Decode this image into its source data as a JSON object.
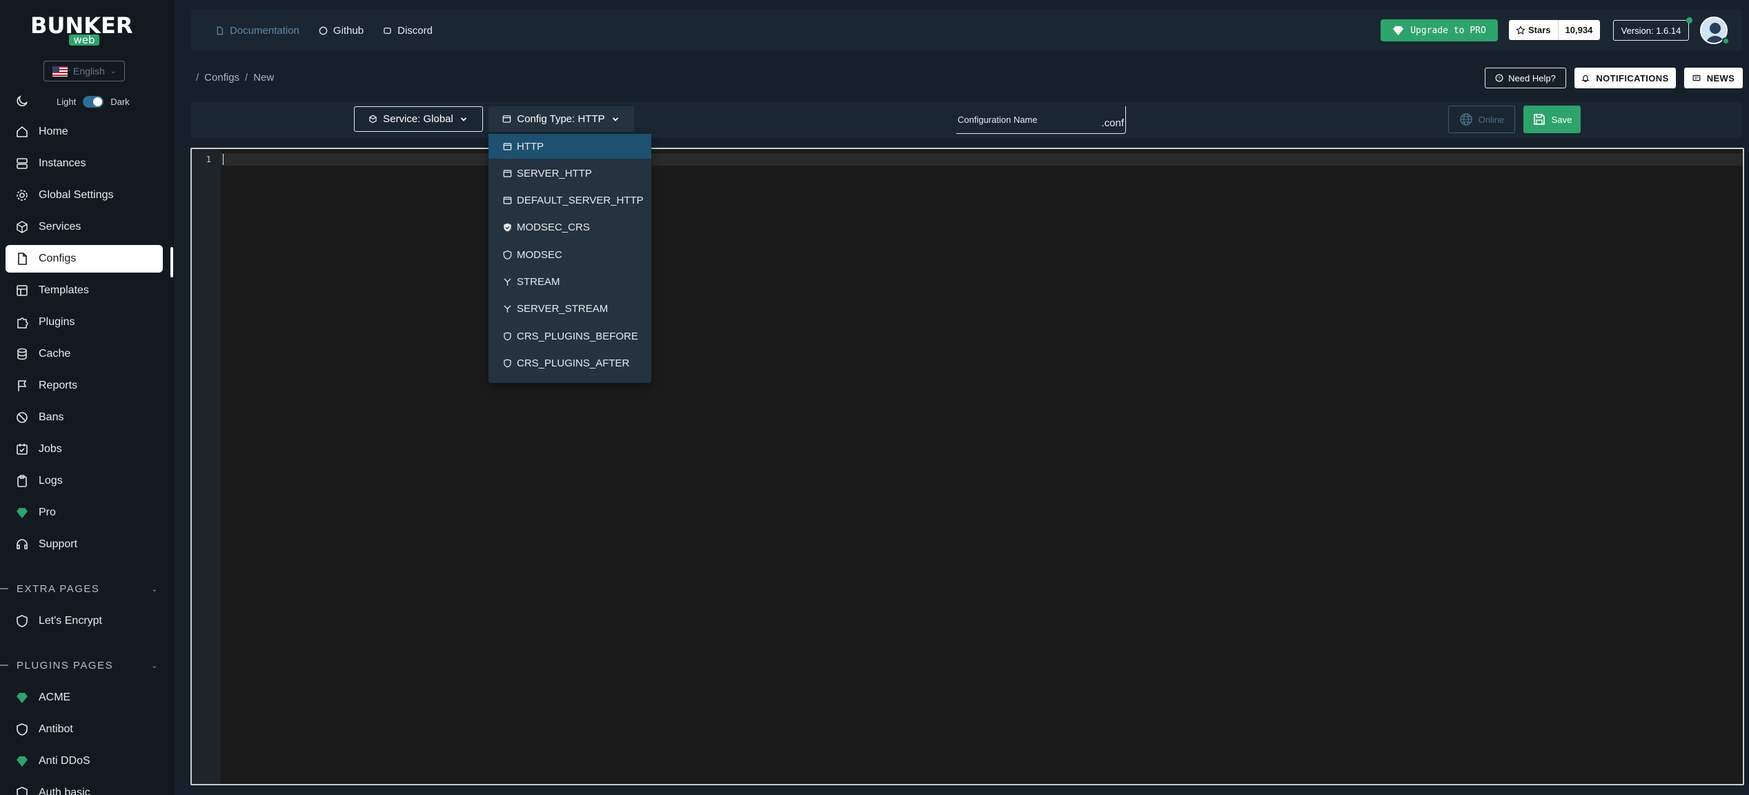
{
  "sidebar": {
    "logo_text": "BUNKER",
    "logo_sub": "web",
    "language": "English",
    "theme": {
      "light": "Light",
      "dark": "Dark"
    },
    "items": [
      {
        "label": "Home",
        "icon": "home-icon"
      },
      {
        "label": "Instances",
        "icon": "server-icon"
      },
      {
        "label": "Global Settings",
        "icon": "gear-icon"
      },
      {
        "label": "Services",
        "icon": "box-icon"
      },
      {
        "label": "Configs",
        "icon": "file-icon"
      },
      {
        "label": "Templates",
        "icon": "template-icon"
      },
      {
        "label": "Plugins",
        "icon": "puzzle-icon"
      },
      {
        "label": "Cache",
        "icon": "database-icon"
      },
      {
        "label": "Reports",
        "icon": "flag-icon"
      },
      {
        "label": "Bans",
        "icon": "ban-icon"
      },
      {
        "label": "Jobs",
        "icon": "calendar-check-icon"
      },
      {
        "label": "Logs",
        "icon": "clipboard-icon"
      },
      {
        "label": "Pro",
        "icon": "diamond-icon"
      },
      {
        "label": "Support",
        "icon": "headset-icon"
      }
    ],
    "extra_pages_title": "EXTRA PAGES",
    "extra_pages": [
      {
        "label": "Let's Encrypt",
        "icon": "shield-icon"
      }
    ],
    "plugins_pages_title": "PLUGINS PAGES",
    "plugins_pages": [
      {
        "label": "ACME",
        "icon": "diamond-icon"
      },
      {
        "label": "Antibot",
        "icon": "shield-icon"
      },
      {
        "label": "Anti DDoS",
        "icon": "diamond-icon"
      },
      {
        "label": "Auth basic",
        "icon": "shield-icon"
      }
    ]
  },
  "topbar": {
    "documentation": "Documentation",
    "github": "Github",
    "discord": "Discord",
    "upgrade": "Upgrade to PRO",
    "stars_label": "Stars",
    "stars_count": "10,934",
    "version": "Version: 1.6.14"
  },
  "breadcrumb": {
    "section": "Configs",
    "page": "New",
    "sep": "/"
  },
  "actions": {
    "help": "Need Help?",
    "notifications": "NOTIFICATIONS",
    "news": "NEWS"
  },
  "toolbar": {
    "service": "Service: Global",
    "config_type": "Config Type: HTTP",
    "name_label": "Configuration Name",
    "name_suffix": ".conf",
    "online": "Online",
    "save": "Save"
  },
  "editor": {
    "line_number": "1"
  },
  "dropdown": {
    "selected": "HTTP",
    "options": [
      {
        "label": "HTTP",
        "icon": "window-icon"
      },
      {
        "label": "SERVER_HTTP",
        "icon": "window-icon"
      },
      {
        "label": "DEFAULT_SERVER_HTTP",
        "icon": "window-icon"
      },
      {
        "label": "MODSEC_CRS",
        "icon": "shield-check-icon"
      },
      {
        "label": "MODSEC",
        "icon": "shield-icon"
      },
      {
        "label": "STREAM",
        "icon": "stream-icon"
      },
      {
        "label": "SERVER_STREAM",
        "icon": "stream-icon"
      },
      {
        "label": "CRS_PLUGINS_BEFORE",
        "icon": "plugin-shield-icon"
      },
      {
        "label": "CRS_PLUGINS_AFTER",
        "icon": "plugin-shield-icon"
      }
    ]
  },
  "colors": {
    "accent_green": "#2ea36b",
    "sidebar_bg": "#12191f",
    "content_bg": "#16202a",
    "panel_bg": "#1a2632",
    "selected_option": "#1e5070"
  }
}
